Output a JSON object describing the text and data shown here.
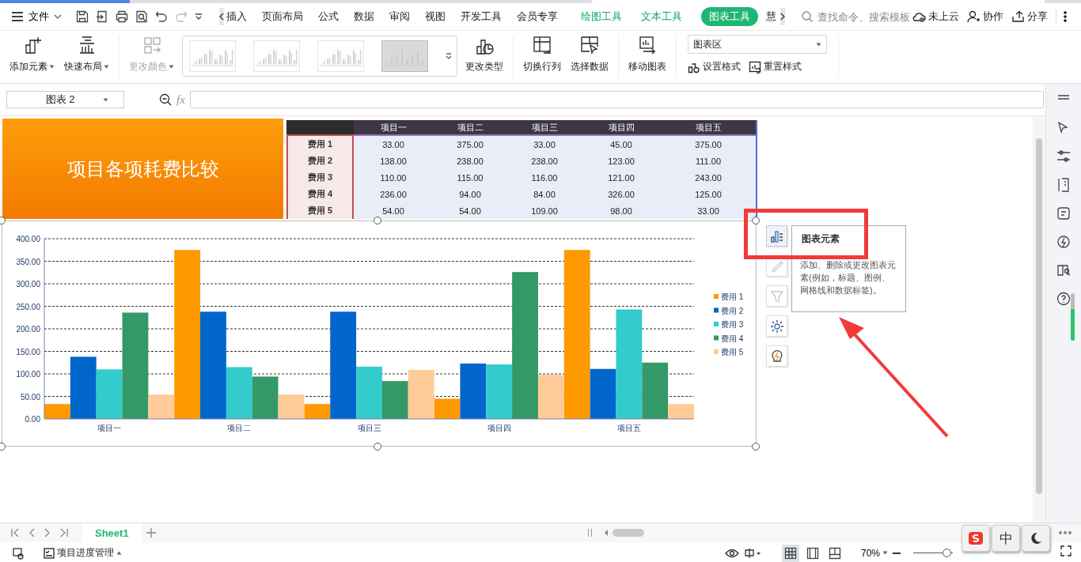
{
  "menu_bar": {
    "file_menu": "文件",
    "tabs": [
      {
        "label": "插入",
        "selected": false
      },
      {
        "label": "页面布局",
        "selected": false
      },
      {
        "label": "公式",
        "selected": false
      },
      {
        "label": "数据",
        "selected": false
      },
      {
        "label": "审阅",
        "selected": false
      },
      {
        "label": "视图",
        "selected": false
      },
      {
        "label": "开发工具",
        "selected": false
      },
      {
        "label": "会员专享",
        "selected": false
      }
    ],
    "context_tabs": [
      {
        "label": "绘图工具",
        "selected": false
      },
      {
        "label": "文本工具",
        "selected": false
      },
      {
        "label": "图表工具",
        "selected": true
      }
    ],
    "overflow_tab": "慧",
    "search": {
      "placeholder": "查找命令、搜索模板"
    },
    "actions": [
      "未上云",
      "协作",
      "分享"
    ]
  },
  "ribbon": {
    "left_buttons": [
      {
        "label": "添加元素",
        "dropdown": true,
        "disabled": false
      },
      {
        "label": "快速布局",
        "dropdown": true,
        "disabled": false
      },
      {
        "label": "更改颜色",
        "dropdown": true,
        "disabled": true
      }
    ],
    "style_gallery": [
      {
        "selected": false
      },
      {
        "selected": false
      },
      {
        "selected": false
      },
      {
        "selected": true
      }
    ],
    "right_buttons": [
      {
        "label": "更改类型"
      },
      {
        "label": "切换行列"
      },
      {
        "label": "选择数据"
      },
      {
        "label": "移动图表"
      }
    ],
    "element_select": "图表区",
    "format_buttons": [
      "设置格式",
      "重置样式"
    ]
  },
  "formula_bar": {
    "name_box": "图表 2",
    "fx": "fx"
  },
  "title_block": "项目各项耗费比较",
  "table": {
    "columns": [
      "项目一",
      "项目二",
      "项目三",
      "项目四",
      "项目五"
    ],
    "rows": [
      {
        "label": "费用 1",
        "values": [
          "33.00",
          "375.00",
          "33.00",
          "45.00",
          "375.00"
        ]
      },
      {
        "label": "费用 2",
        "values": [
          "138.00",
          "238.00",
          "238.00",
          "123.00",
          "111.00"
        ]
      },
      {
        "label": "费用 3",
        "values": [
          "110.00",
          "115.00",
          "116.00",
          "121.00",
          "243.00"
        ]
      },
      {
        "label": "费用 4",
        "values": [
          "236.00",
          "94.00",
          "84.00",
          "326.00",
          "125.00"
        ]
      },
      {
        "label": "费用 5",
        "values": [
          "54.00",
          "54.00",
          "109.00",
          "98.00",
          "33.00"
        ]
      }
    ]
  },
  "chart": {
    "chart_data": {
      "type": "bar",
      "grid": true,
      "legend": true,
      "categories": [
        "项目一",
        "项目二",
        "项目三",
        "项目四",
        "项目五"
      ],
      "ylim": [
        0,
        400
      ],
      "yticks": [
        {
          "value": 0,
          "label": "0.00"
        },
        {
          "value": 50,
          "label": "50.00"
        },
        {
          "value": 100,
          "label": "100.00"
        },
        {
          "value": 150,
          "label": "150.00"
        },
        {
          "value": 200,
          "label": "200.00"
        },
        {
          "value": 250,
          "label": "250.00"
        },
        {
          "value": 300,
          "label": "300.00"
        },
        {
          "value": 350,
          "label": "350.00"
        },
        {
          "value": 400,
          "label": "400.00"
        }
      ],
      "series": [
        {
          "name": "费用 1",
          "color": "#ff9900",
          "values": [
            33,
            375,
            33,
            45,
            375
          ]
        },
        {
          "name": "费用 2",
          "color": "#0066cc",
          "values": [
            138,
            238,
            238,
            123,
            111
          ]
        },
        {
          "name": "费用 3",
          "color": "#33cccc",
          "values": [
            110,
            115,
            116,
            121,
            243
          ]
        },
        {
          "name": "费用 4",
          "color": "#339966",
          "values": [
            236,
            94,
            84,
            326,
            125
          ]
        },
        {
          "name": "费用 5",
          "color": "#ffcc99",
          "values": [
            54,
            54,
            109,
            98,
            33
          ]
        }
      ]
    }
  },
  "chart_tools": [
    {
      "selected": true,
      "disabled": false
    },
    {
      "selected": false,
      "disabled": true
    },
    {
      "selected": false,
      "disabled": true
    },
    {
      "selected": false,
      "disabled": false
    },
    {
      "selected": false,
      "disabled": false
    }
  ],
  "tooltip": {
    "title": "图表元素",
    "description": "添加、删除或更改图表元素(例如，标题、图例、网格线和数据标签)。"
  },
  "sheet_tabs": [
    {
      "label": "Sheet1",
      "selected": true
    }
  ],
  "status_bar": {
    "workbook": "项目进度管理",
    "view_buttons": [
      {
        "selected": true
      },
      {
        "selected": false
      },
      {
        "selected": false
      }
    ],
    "zoom": "70%",
    "zoom_slider": {
      "level": 0.95
    }
  },
  "ime_toolbar": {
    "mode": "中"
  }
}
